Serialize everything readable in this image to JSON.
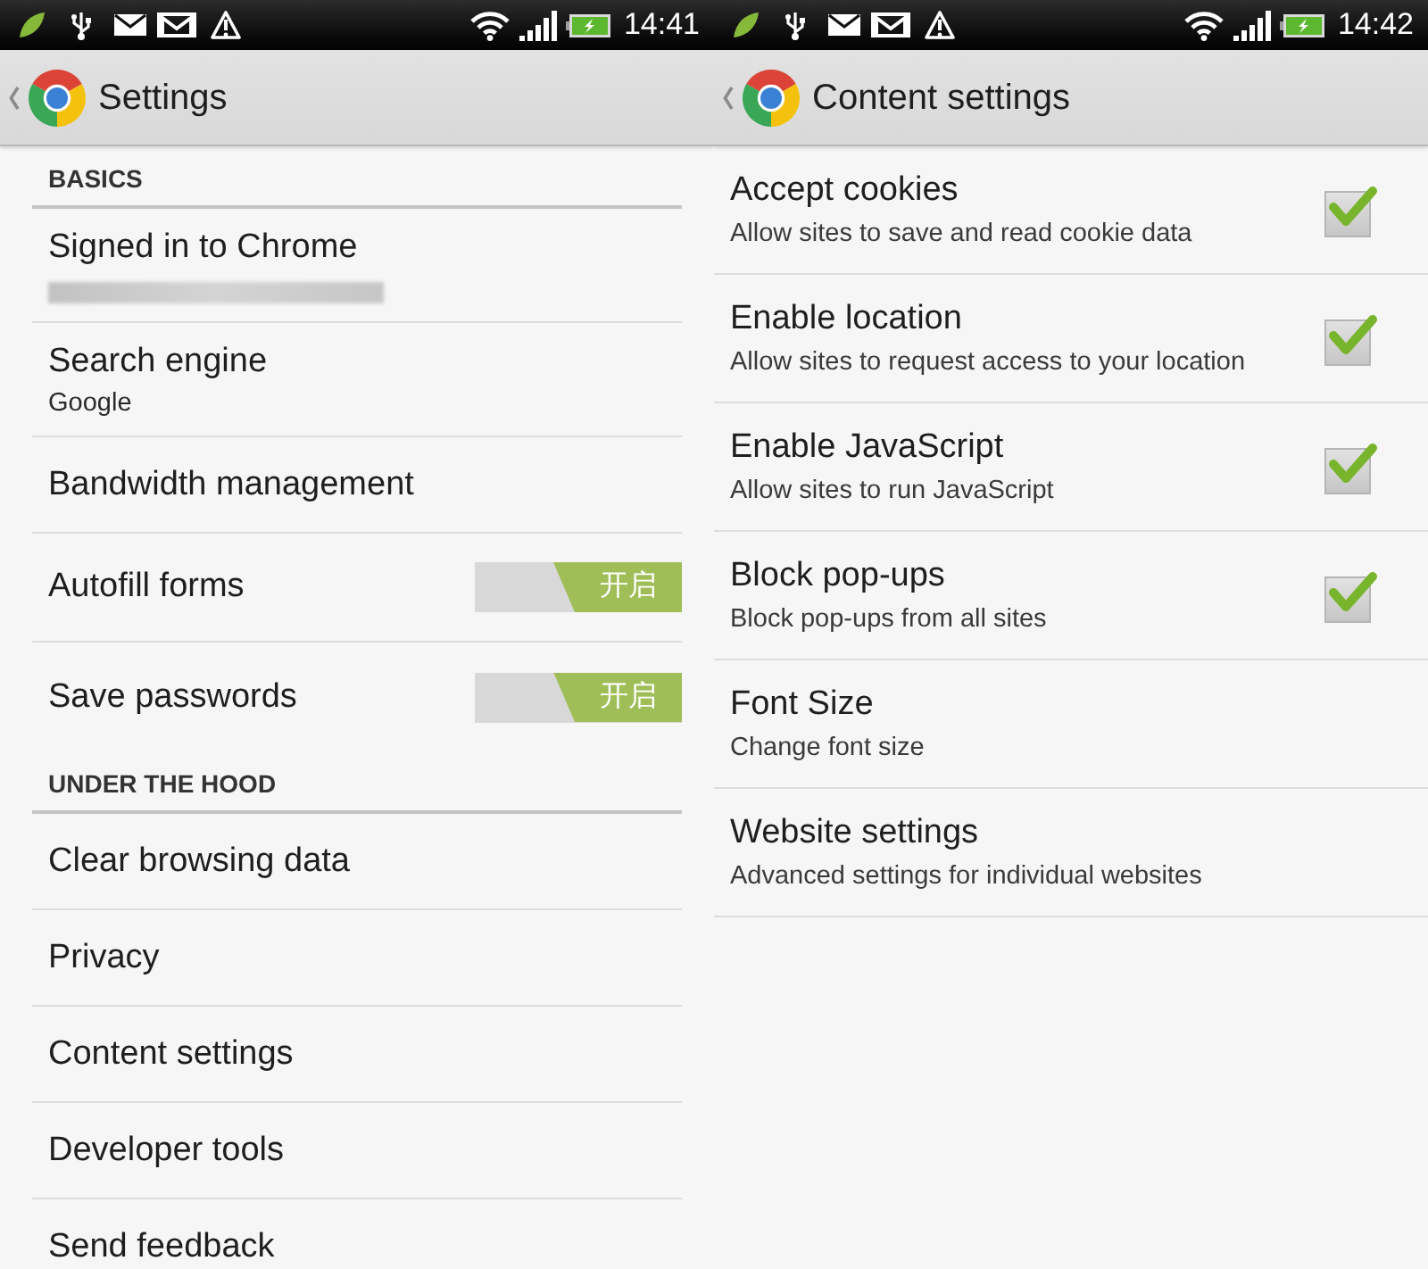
{
  "screens": [
    {
      "status_bar": {
        "time": "14:41"
      },
      "app_bar": {
        "title": "Settings"
      },
      "sections": [
        {
          "header": "BASICS",
          "items": [
            {
              "kind": "account",
              "title": "Signed in to Chrome"
            },
            {
              "kind": "plain",
              "title": "Search engine",
              "subtitle": "Google"
            },
            {
              "kind": "plain",
              "title": "Bandwidth management"
            },
            {
              "kind": "toggle",
              "title": "Autofill forms",
              "on": true,
              "switch_label": "开启"
            },
            {
              "kind": "toggle",
              "title": "Save passwords",
              "on": true,
              "switch_label": "开启"
            }
          ]
        },
        {
          "header": "UNDER THE HOOD",
          "items": [
            {
              "kind": "plain",
              "title": "Clear browsing data"
            },
            {
              "kind": "plain",
              "title": "Privacy"
            },
            {
              "kind": "plain",
              "title": "Content settings"
            },
            {
              "kind": "plain",
              "title": "Developer tools"
            },
            {
              "kind": "plain",
              "title": "Send feedback"
            }
          ]
        }
      ]
    },
    {
      "status_bar": {
        "time": "14:42"
      },
      "app_bar": {
        "title": "Content settings"
      },
      "items": [
        {
          "kind": "checkbox",
          "title": "Accept cookies",
          "subtitle": "Allow sites to save and read cookie data",
          "checked": true
        },
        {
          "kind": "checkbox",
          "title": "Enable location",
          "subtitle": "Allow sites to request access to your location",
          "checked": true
        },
        {
          "kind": "checkbox",
          "title": "Enable JavaScript",
          "subtitle": "Allow sites to run JavaScript",
          "checked": true
        },
        {
          "kind": "checkbox",
          "title": "Block pop-ups",
          "subtitle": "Block pop-ups from all sites",
          "checked": true
        },
        {
          "kind": "plain",
          "title": "Font Size",
          "subtitle": "Change font size"
        },
        {
          "kind": "plain",
          "title": "Website settings",
          "subtitle": "Advanced settings for individual websites"
        }
      ]
    }
  ]
}
